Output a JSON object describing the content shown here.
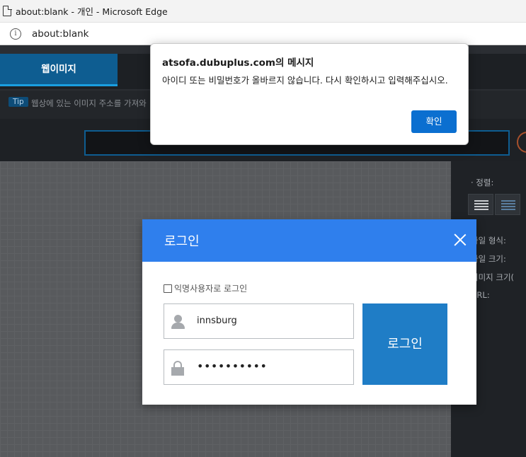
{
  "browser": {
    "window_title": "about:blank - 개인 - Microsoft Edge",
    "address": "about:blank"
  },
  "page": {
    "tab_active_label": "웹이미지",
    "tip_badge": "Tip",
    "tip_text": "웹상에 있는 이미지 주소를 가져와",
    "side_labels": {
      "align": "· 정렬:",
      "file_type": "파일 형식:",
      "file_size": "파일 크기:",
      "image_size": "이미지 크기(",
      "url": "URL:"
    }
  },
  "login_modal": {
    "title": "로그인",
    "anonymous_label": "익명사용자로 로그인",
    "username_value": "innsburg",
    "password_value": "••••••••••",
    "login_button": "로그인"
  },
  "alert": {
    "title": "atsofa.dubuplus.com의 메시지",
    "message": "아이디 또는 비밀번호가 올바르지 않습니다. 다시 확인하시고 입력해주십시오.",
    "ok_label": "확인"
  },
  "colors": {
    "modal_header": "#2f7fed",
    "login_button": "#1f7dc6",
    "alert_ok": "#0b6fd0"
  }
}
